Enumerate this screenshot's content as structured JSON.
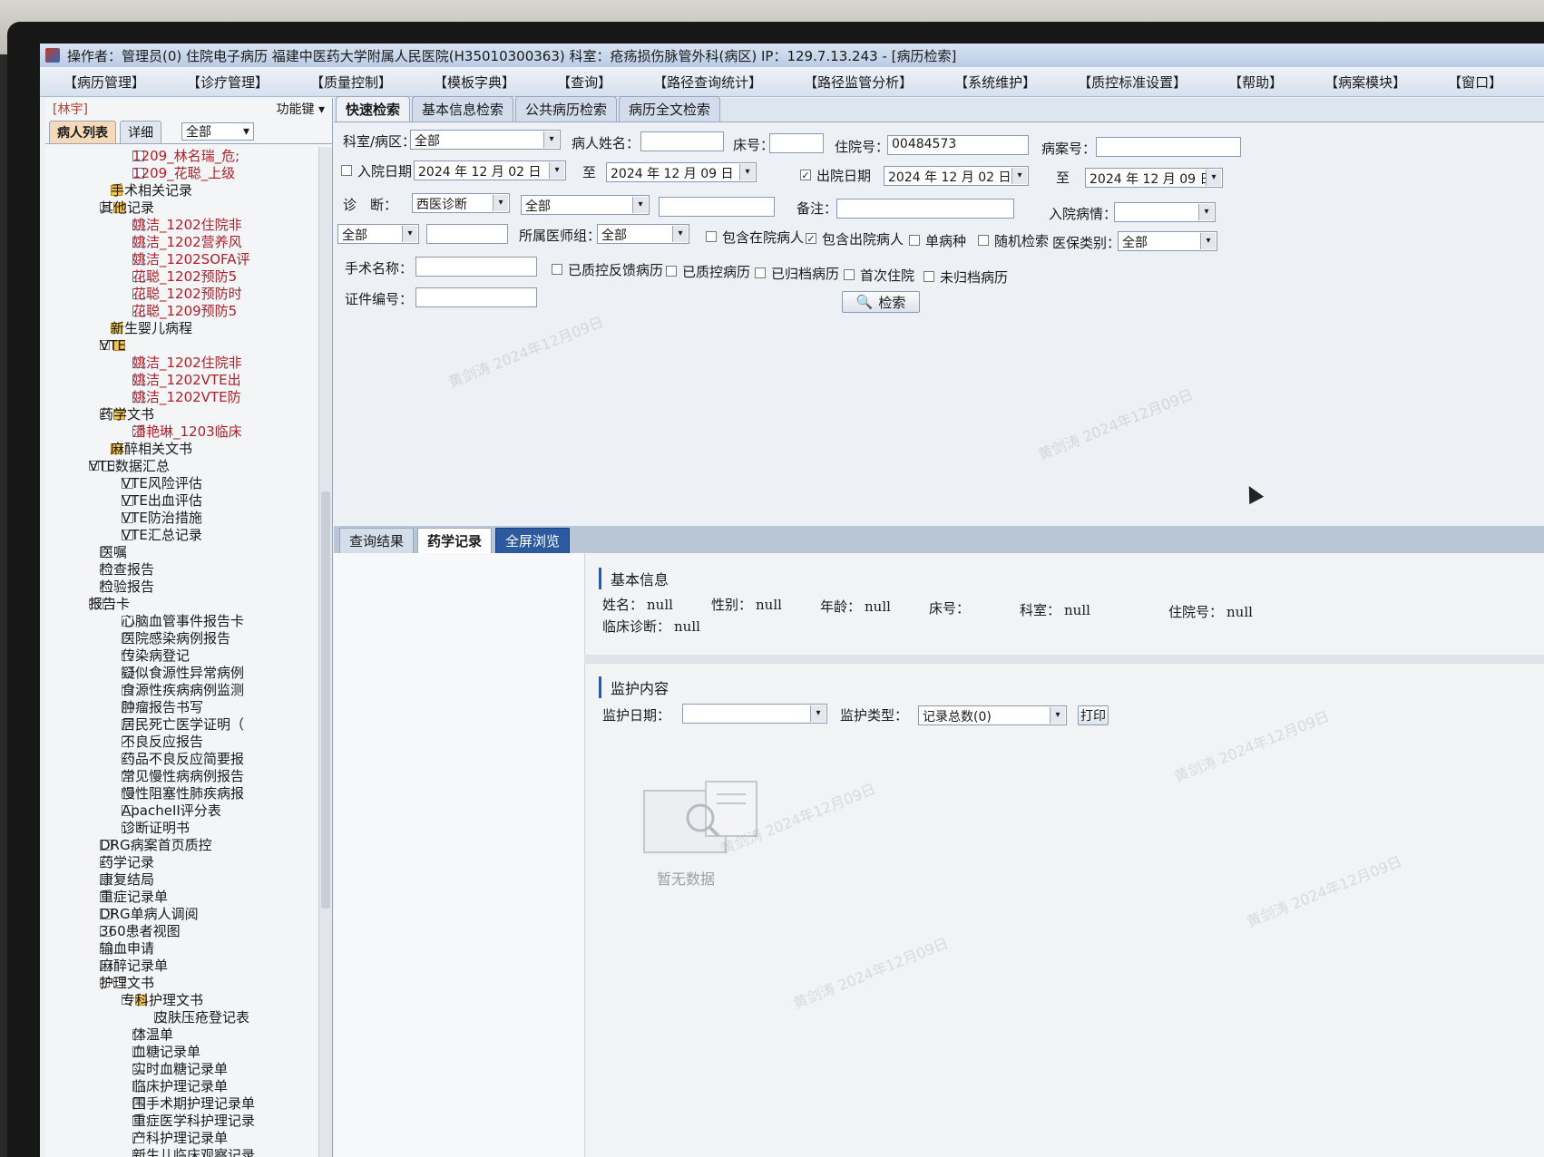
{
  "window": {
    "title": "操作者：管理员(0) 住院电子病历 福建中医药大学附属人民医院(H35010300363) 科室：疮疡损伤脉管外科(病区) IP：129.7.13.243 - [病历检索]"
  },
  "menu": [
    "【病历管理】",
    "【诊疗管理】",
    "【质量控制】",
    "【模板字典】",
    "【查询】",
    "【路径查询统计】",
    "【路径监管分析】",
    "【系统维护】",
    "【质控标准设置】",
    "【帮助】",
    "【病案模块】",
    "【窗口】"
  ],
  "left": {
    "user": "[林宇]",
    "func_key": "功能键",
    "tab_list": "病人列表",
    "tab_detail": "详细",
    "filter_value": "全部",
    "tree": [
      {
        "label": "1209_林名瑞_危;",
        "red": true,
        "indent": 8,
        "icon": "doc"
      },
      {
        "label": "1209_花聪_上级",
        "red": true,
        "indent": 8,
        "icon": "doc"
      },
      {
        "label": "手术相关记录",
        "red": false,
        "indent": 6,
        "icon": "folder"
      },
      {
        "label": "其他记录",
        "red": false,
        "indent": 5,
        "icon": "folder",
        "exp": "−"
      },
      {
        "label": "姚洁_1202住院非",
        "red": true,
        "indent": 8,
        "icon": "doc"
      },
      {
        "label": "姚洁_1202营养风",
        "red": true,
        "indent": 8,
        "icon": "doc"
      },
      {
        "label": "姚洁_1202SOFA评",
        "red": true,
        "indent": 8,
        "icon": "doc"
      },
      {
        "label": "花聪_1202预防5",
        "red": true,
        "indent": 8,
        "icon": "doc"
      },
      {
        "label": "花聪_1202预防时",
        "red": true,
        "indent": 8,
        "icon": "doc"
      },
      {
        "label": "花聪_1209预防5",
        "red": true,
        "indent": 8,
        "icon": "doc"
      },
      {
        "label": "新生婴儿病程",
        "red": false,
        "indent": 6,
        "icon": "folder"
      },
      {
        "label": "VTE",
        "red": false,
        "indent": 5,
        "icon": "folder",
        "exp": "−"
      },
      {
        "label": "姚洁_1202住院非",
        "red": true,
        "indent": 8,
        "icon": "doc"
      },
      {
        "label": "姚洁_1202VTE出",
        "red": true,
        "indent": 8,
        "icon": "doc"
      },
      {
        "label": "姚洁_1202VTE防",
        "red": true,
        "indent": 8,
        "icon": "doc"
      },
      {
        "label": "药学文书",
        "red": false,
        "indent": 5,
        "icon": "folder",
        "exp": "−"
      },
      {
        "label": "潘艳琳_1203临床",
        "red": true,
        "indent": 8,
        "icon": "doc"
      },
      {
        "label": "麻醉相关文书",
        "red": false,
        "indent": 6,
        "icon": "folder"
      },
      {
        "label": "VTE数据汇总",
        "red": false,
        "indent": 4,
        "icon": "doc",
        "exp": "−"
      },
      {
        "label": "VTE风险评估",
        "red": false,
        "indent": 7,
        "icon": "doc"
      },
      {
        "label": "VTE出血评估",
        "red": false,
        "indent": 7,
        "icon": "doc"
      },
      {
        "label": "VTE防治措施",
        "red": false,
        "indent": 7,
        "icon": "doc"
      },
      {
        "label": "VTE汇总记录",
        "red": false,
        "indent": 7,
        "icon": "doc"
      },
      {
        "label": "医嘱",
        "red": false,
        "indent": 5,
        "icon": "doc"
      },
      {
        "label": "检查报告",
        "red": false,
        "indent": 5,
        "icon": "doc"
      },
      {
        "label": "检验报告",
        "red": false,
        "indent": 5,
        "icon": "doc"
      },
      {
        "label": "报告卡",
        "red": false,
        "indent": 4,
        "icon": "doc",
        "exp": "−"
      },
      {
        "label": "心脑血管事件报告卡",
        "red": false,
        "indent": 7,
        "icon": "doc"
      },
      {
        "label": "医院感染病例报告",
        "red": false,
        "indent": 7,
        "icon": "doc"
      },
      {
        "label": "传染病登记",
        "red": false,
        "indent": 7,
        "icon": "doc"
      },
      {
        "label": "疑似食源性异常病例",
        "red": false,
        "indent": 7,
        "icon": "doc"
      },
      {
        "label": "食源性疾病病例监测",
        "red": false,
        "indent": 7,
        "icon": "doc"
      },
      {
        "label": "肿瘤报告书写",
        "red": false,
        "indent": 7,
        "icon": "doc"
      },
      {
        "label": "居民死亡医学证明（",
        "red": false,
        "indent": 7,
        "icon": "doc"
      },
      {
        "label": "不良反应报告",
        "red": false,
        "indent": 7,
        "icon": "doc"
      },
      {
        "label": "药品不良反应简要报",
        "red": false,
        "indent": 7,
        "icon": "doc"
      },
      {
        "label": "常见慢性病病例报告",
        "red": false,
        "indent": 7,
        "icon": "doc"
      },
      {
        "label": "慢性阻塞性肺疾病报",
        "red": false,
        "indent": 7,
        "icon": "doc"
      },
      {
        "label": "ApacheII评分表",
        "red": false,
        "indent": 7,
        "icon": "doc"
      },
      {
        "label": "诊断证明书",
        "red": false,
        "indent": 7,
        "icon": "doc"
      },
      {
        "label": "DRG病案首页质控",
        "red": false,
        "indent": 5,
        "icon": "doc"
      },
      {
        "label": "药学记录",
        "red": false,
        "indent": 5,
        "icon": "doc"
      },
      {
        "label": "康复结局",
        "red": false,
        "indent": 5,
        "icon": "doc"
      },
      {
        "label": "重症记录单",
        "red": false,
        "indent": 5,
        "icon": "doc"
      },
      {
        "label": "DRG单病人调阅",
        "red": false,
        "indent": 5,
        "icon": "doc"
      },
      {
        "label": "360患者视图",
        "red": false,
        "indent": 5,
        "icon": "doc"
      },
      {
        "label": "输血申请",
        "red": false,
        "indent": 5,
        "icon": "doc"
      },
      {
        "label": "麻醉记录单",
        "red": false,
        "indent": 5,
        "icon": "doc"
      },
      {
        "label": "护理文书",
        "red": false,
        "indent": 5,
        "icon": "doc",
        "exp": "−"
      },
      {
        "label": "专科护理文书",
        "red": false,
        "indent": 7,
        "icon": "folder",
        "exp": "−"
      },
      {
        "label": "皮肤压疮登记表",
        "red": false,
        "indent": 10,
        "icon": "doc"
      },
      {
        "label": "体温单",
        "red": false,
        "indent": 8,
        "icon": "doc"
      },
      {
        "label": "血糖记录单",
        "red": false,
        "indent": 8,
        "icon": "doc"
      },
      {
        "label": "实时血糖记录单",
        "red": false,
        "indent": 8,
        "icon": "doc"
      },
      {
        "label": "临床护理记录单",
        "red": false,
        "indent": 8,
        "icon": "doc"
      },
      {
        "label": "围手术期护理记录单",
        "red": false,
        "indent": 8,
        "icon": "doc"
      },
      {
        "label": "重症医学科护理记录",
        "red": false,
        "indent": 8,
        "icon": "doc"
      },
      {
        "label": "产科护理记录单",
        "red": false,
        "indent": 8,
        "icon": "doc"
      },
      {
        "label": "新生儿临床观察记录",
        "red": false,
        "indent": 8,
        "icon": "doc"
      }
    ]
  },
  "tabs": [
    "快速检索",
    "基本信息检索",
    "公共病历检索",
    "病历全文检索"
  ],
  "form": {
    "dept_label": "科室/病区：",
    "dept_value": "全部",
    "patient_name_label": "病人姓名：",
    "patient_name_value": "",
    "bed_label": "床号：",
    "bed_value": "",
    "inpatient_no_label": "住院号：",
    "inpatient_no_value": "00484573",
    "case_no_label": "病案号：",
    "case_no_value": "",
    "admit_date_label": "入院日期",
    "admit_from": "2024 年 12 月 02 日",
    "to_label": "至",
    "admit_to": "2024 年 12 月 09 日",
    "discharge_date_label": "出院日期",
    "discharge_from": "2024 年 12 月 02 日",
    "discharge_to": "2024 年 12 月 09 日",
    "diag_label": "诊　断：",
    "diag_type": "西医诊断",
    "diag_scope": "全部",
    "diag_text": "",
    "remark_label": "备注：",
    "remark_value": "",
    "admit_cond_label": "入院病情：",
    "admit_cond_value": "",
    "extra_select": "全部",
    "extra_text": "",
    "doctor_group_label": "所属医师组：",
    "doctor_group_value": "全部",
    "include_inpatient": "包含在院病人",
    "include_discharged": "包含出院病人",
    "single_disease": "单病种",
    "random_search": "随机检索",
    "insurance_label": "医保类别：",
    "insurance_value": "全部",
    "surgery_label": "手术名称：",
    "surgery_value": "",
    "qc_feedback": "已质控反馈病历",
    "qc_done": "已质控病历",
    "archived": "已归档病历",
    "first_admit": "首次住院",
    "not_archived": "未归档病历",
    "cert_label": "证件编号：",
    "cert_value": "",
    "search_button": "检索"
  },
  "result_tabs": [
    "查询结果",
    "药学记录",
    "全屏浏览"
  ],
  "basic": {
    "title": "基本信息",
    "name_label": "姓名：",
    "name": "null",
    "gender_label": "性别：",
    "gender": "null",
    "age_label": "年龄：",
    "age": "null",
    "bed_label": "床号：",
    "bed": "",
    "dept_label": "科室：",
    "dept": "null",
    "inpatient_label": "住院号：",
    "inpatient": "null",
    "diag_label": "临床诊断：",
    "diag": "null"
  },
  "monitor": {
    "title": "监护内容",
    "date_label": "监护日期：",
    "date_value": "",
    "type_label": "监护类型：",
    "type_value": "记录总数(0)",
    "print_button": "打印",
    "empty_text": "暂无数据"
  },
  "watermark": "黄剑涛 2024年12月09日"
}
